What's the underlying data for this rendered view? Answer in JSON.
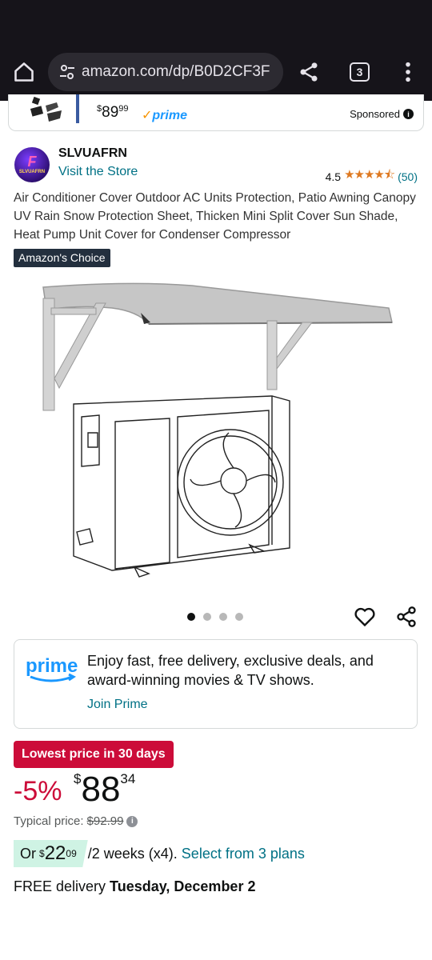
{
  "browser": {
    "url": "amazon.com/dp/B0D2CF3F",
    "tab_count": "3",
    "icons": [
      "home-icon",
      "tune-icon",
      "share-icon",
      "tabs-icon",
      "more-vert-icon"
    ]
  },
  "sponsored": {
    "price_whole": "89",
    "price_fraction": "99",
    "price_currency": "$",
    "prime_label": "prime",
    "label": "Sponsored",
    "info_icon": "i"
  },
  "brand": {
    "logo_text": "SLVUAFRN",
    "name": "SLVUAFRN",
    "store_link": "Visit the Store"
  },
  "rating": {
    "value": "4.5",
    "stars": 4.5,
    "count": "(50)"
  },
  "product": {
    "title": "Air Conditioner Cover Outdoor AC Units Protection, Patio Awning Canopy UV Rain Snow Protection Sheet, Thicken Mini Split Cover Sun Shade, Heat Pump Unit Cover for Condenser Compressor",
    "badge": "Amazon's Choice",
    "image_count": 4,
    "active_image": 0
  },
  "prime_card": {
    "logo": "prime",
    "message": "Enjoy fast, free delivery, exclusive deals, and award-winning movies & TV shows.",
    "link": "Join Prime"
  },
  "pricing": {
    "deal_badge": "Lowest price in 30 days",
    "discount": "-5%",
    "currency": "$",
    "price_whole": "88",
    "price_fraction": "34",
    "typical_label": "Typical price:",
    "typical_price": "$92.99",
    "installment_or": "Or",
    "installment_currency": "$",
    "installment_whole": "22",
    "installment_fraction": "09",
    "installment_rest": "/2 weeks (x4).",
    "installment_link": "Select from 3 plans"
  },
  "delivery": {
    "prefix": "FREE delivery",
    "date": "Tuesday, December 2"
  },
  "colors": {
    "link": "#007185",
    "deal_red": "#cc0c39",
    "star": "#de7921",
    "prime_blue": "#1a98ff"
  }
}
